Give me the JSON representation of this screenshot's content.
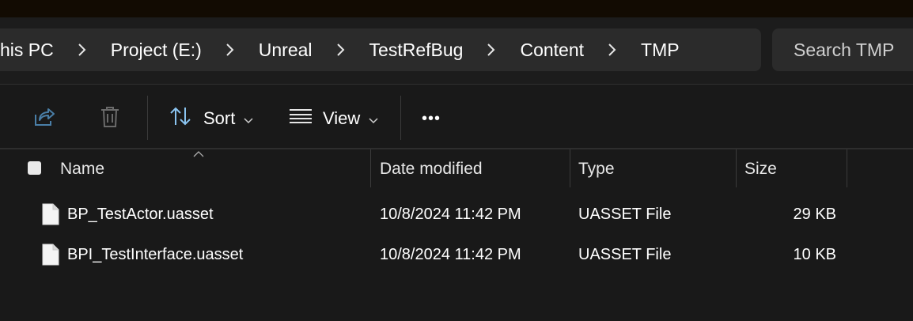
{
  "breadcrumb": {
    "items": [
      "his PC",
      "Project (E:)",
      "Unreal",
      "TestRefBug",
      "Content",
      "TMP"
    ]
  },
  "search": {
    "placeholder": "Search TMP"
  },
  "toolbar": {
    "sort_label": "Sort",
    "view_label": "View",
    "more_label": "•••"
  },
  "columns": {
    "name": "Name",
    "date": "Date modified",
    "type": "Type",
    "size": "Size"
  },
  "files": [
    {
      "name": "BP_TestActor.uasset",
      "date": "10/8/2024 11:42 PM",
      "type": "UASSET File",
      "size": "29 KB"
    },
    {
      "name": "BPI_TestInterface.uasset",
      "date": "10/8/2024 11:42 PM",
      "type": "UASSET File",
      "size": "10 KB"
    }
  ],
  "colors": {
    "background": "#191919",
    "address_bar": "#2b2b2b",
    "text": "#ffffff"
  }
}
